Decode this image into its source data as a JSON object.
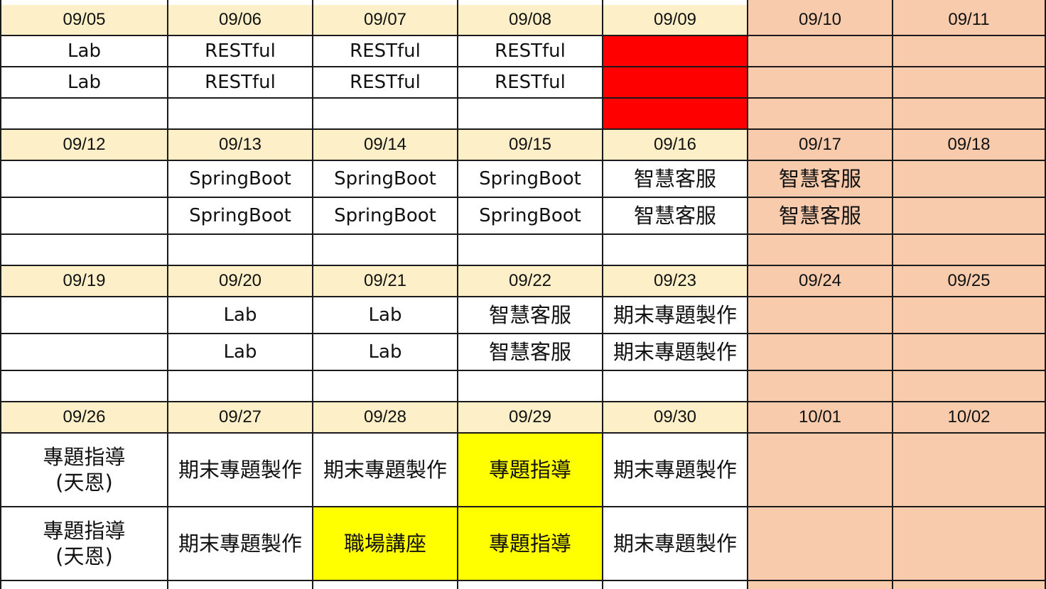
{
  "sheet": {
    "weeks": [
      {
        "dates": [
          "09/05",
          "09/06",
          "09/07",
          "09/08",
          "09/09",
          "09/10",
          "09/11"
        ],
        "rows": [
          [
            "Lab",
            "RESTful",
            "RESTful",
            "RESTful",
            "",
            "",
            ""
          ],
          [
            "Lab",
            "RESTful",
            "RESTful",
            "RESTful",
            "",
            "",
            ""
          ],
          [
            "",
            "",
            "",
            "",
            "",
            "",
            ""
          ]
        ]
      },
      {
        "dates": [
          "09/12",
          "09/13",
          "09/14",
          "09/15",
          "09/16",
          "09/17",
          "09/18"
        ],
        "rows": [
          [
            "",
            "SpringBoot",
            "SpringBoot",
            "SpringBoot",
            "智慧客服",
            "智慧客服",
            ""
          ],
          [
            "",
            "SpringBoot",
            "SpringBoot",
            "SpringBoot",
            "智慧客服",
            "智慧客服",
            ""
          ],
          [
            "",
            "",
            "",
            "",
            "",
            "",
            ""
          ]
        ]
      },
      {
        "dates": [
          "09/19",
          "09/20",
          "09/21",
          "09/22",
          "09/23",
          "09/24",
          "09/25"
        ],
        "rows": [
          [
            "",
            "Lab",
            "Lab",
            "智慧客服",
            "期末專題製作",
            "",
            ""
          ],
          [
            "",
            "Lab",
            "Lab",
            "智慧客服",
            "期末專題製作",
            "",
            ""
          ],
          [
            "",
            "",
            "",
            "",
            "",
            "",
            ""
          ]
        ]
      },
      {
        "dates": [
          "09/26",
          "09/27",
          "09/28",
          "09/29",
          "09/30",
          "10/01",
          "10/02"
        ],
        "rows": [
          [
            "專題指導\n(天恩)",
            "期末專題製作",
            "期末專題製作",
            "專題指導",
            "期末專題製作",
            "",
            ""
          ],
          [
            "專題指導\n(天恩)",
            "期末專題製作",
            "職場講座",
            "專題指導",
            "期末專題製作",
            "",
            ""
          ]
        ]
      }
    ]
  },
  "colors": {
    "header_bg": "#fdefc7",
    "weekend_bg": "#f8cbad",
    "holiday_red": "#ff0000",
    "highlight_yellow": "#ffff00",
    "grid_line": "#1a1a1a"
  },
  "highlights": {
    "red_cells": [
      [
        0,
        0,
        4
      ],
      [
        0,
        1,
        4
      ],
      [
        0,
        2,
        4
      ]
    ],
    "yellow_cells": [
      [
        3,
        0,
        3
      ],
      [
        3,
        1,
        2
      ],
      [
        3,
        1,
        3
      ]
    ]
  }
}
